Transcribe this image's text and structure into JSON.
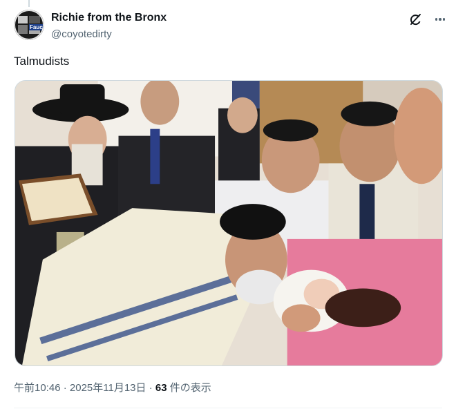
{
  "author": {
    "display_name": "Richie from the Bronx",
    "handle": "@coyotedirty",
    "avatar_icon": "profile-avatar",
    "avatar_badge": "Fauci"
  },
  "actions": {
    "grok_icon": "grok-icon",
    "more_icon": "more-icon"
  },
  "tweet": {
    "text": "Talmudists"
  },
  "media": {
    "type": "photo"
  },
  "meta": {
    "time": "午前10:46",
    "separator": "·",
    "date": "2025年11月13日",
    "views_count": "63",
    "views_label": "件の表示"
  },
  "colors": {
    "text": "#0f1419",
    "secondary": "#536471",
    "border": "#cfd9de"
  }
}
